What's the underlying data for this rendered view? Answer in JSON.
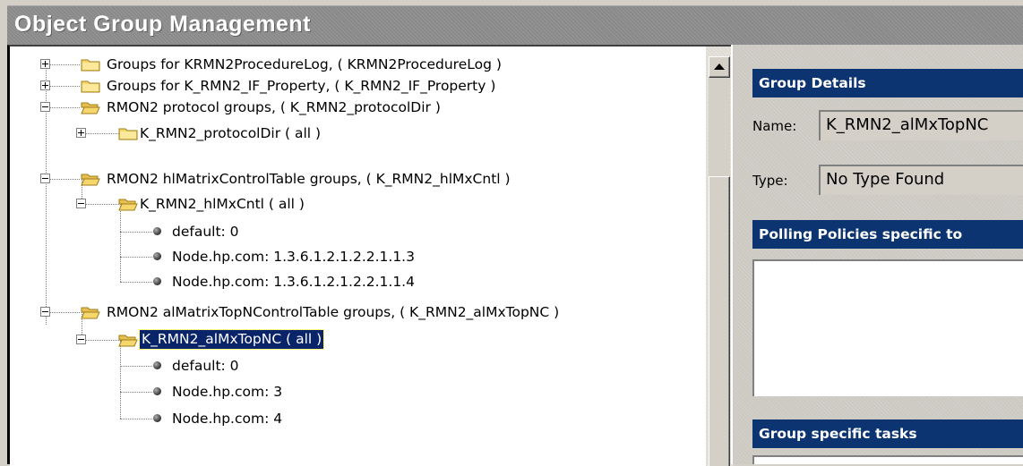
{
  "title": "Object Group Management",
  "tree": {
    "rows": [
      {
        "label": "Groups for KRMN2ProcedureLog, ( KRMN2ProcedureLog )",
        "expander": "plus",
        "icon": "folder-icon"
      },
      {
        "label": "Groups for K_RMN2_IF_Property, ( K_RMN2_IF_Property )",
        "expander": "plus",
        "icon": "folder-icon"
      },
      {
        "label": "RMON2 protocol groups, ( K_RMN2_protocolDir )",
        "expander": "minus",
        "icon": "open-folder-icon"
      },
      {
        "label": "K_RMN2_protocolDir ( all )",
        "expander": "plus",
        "icon": "folder-icon"
      },
      {
        "label": "RMON2 hlMatrixControlTable groups, ( K_RMN2_hlMxCntl )",
        "expander": "minus",
        "icon": "open-folder-icon"
      },
      {
        "label": "K_RMN2_hlMxCntl ( all )",
        "expander": "minus",
        "icon": "open-folder-icon"
      },
      {
        "label": "default: 0",
        "icon": "bullet-icon"
      },
      {
        "label": "Node.hp.com: 1.3.6.1.2.1.2.2.1.1.3",
        "icon": "bullet-icon"
      },
      {
        "label": "Node.hp.com: 1.3.6.1.2.1.2.2.1.1.4",
        "icon": "bullet-icon"
      },
      {
        "label": "RMON2 alMatrixTopNControlTable groups, ( K_RMN2_alMxTopNC )",
        "expander": "minus",
        "icon": "open-folder-icon"
      },
      {
        "label": "K_RMN2_alMxTopNC ( all )",
        "expander": "minus",
        "icon": "open-folder-icon",
        "selected": true
      },
      {
        "label": "default: 0",
        "icon": "bullet-icon"
      },
      {
        "label": "Node.hp.com: 3",
        "icon": "bullet-icon"
      },
      {
        "label": "Node.hp.com: 4",
        "icon": "bullet-icon"
      }
    ]
  },
  "details": {
    "header": "Group Details",
    "name_label": "Name:",
    "name_value": "K_RMN2_alMxTopNC",
    "type_label": "Type:",
    "type_value": "No Type Found"
  },
  "polling": {
    "header": "Polling Policies specific to"
  },
  "tasks": {
    "header": "Group specific tasks"
  },
  "colors": {
    "selection": "#0a246a",
    "section_header": "#0b3471",
    "titlebar": "#8a8a8a"
  }
}
